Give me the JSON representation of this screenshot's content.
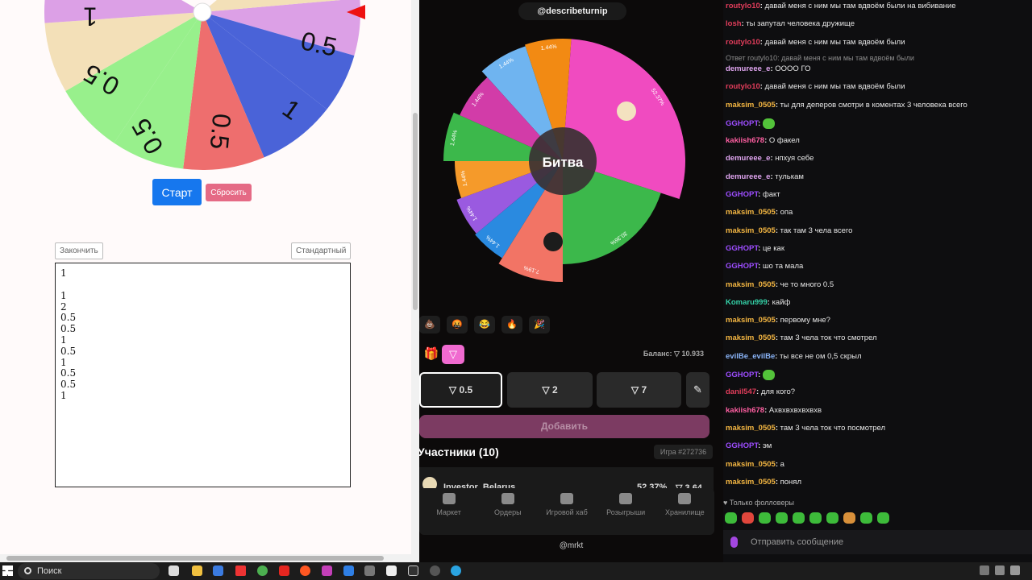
{
  "left": {
    "wheel_labels": [
      "0.5",
      "0.5",
      "0.5",
      "1",
      "0.5",
      "1"
    ],
    "start_label": "Старт",
    "reset_label": "Сбросить",
    "finish_label": "Закончить",
    "standard_label": "Стандартный",
    "textarea_lines": [
      "1",
      "",
      "1",
      "2",
      "0.5",
      "0.5",
      "1",
      "0.5",
      "1",
      "0.5",
      "0.5",
      "1"
    ]
  },
  "middle": {
    "top_user": "@describeturnip",
    "battle_label": "Битва",
    "segment_labels": [
      "1.44%",
      "1.44%",
      "52.37%",
      "30.36%",
      "7.19%",
      "1.44%",
      "1.44%",
      "1.44%",
      "1.44%",
      "1.44%"
    ],
    "emojis": [
      "💩",
      "🤬",
      "😂",
      "🔥",
      "🎉"
    ],
    "balance": "Баланс: ▽ 10.933",
    "bets": [
      "▽ 0.5",
      "▽ 2",
      "▽ 7"
    ],
    "add_label": "Добавить",
    "participants": "Участники (10)",
    "game_id": "Игра #272736",
    "participant_row": {
      "name": "Investor_Belarus",
      "percent": "52.37%",
      "amount": "▽ 3.64"
    },
    "nav": [
      "Маркет",
      "Ордеры",
      "Игровой хаб",
      "Розыгрыши",
      "Хранилище"
    ],
    "bottom_user": "@mrkt"
  },
  "chat": {
    "messages": [
      {
        "user": "routylo10",
        "color": "#e23d5b",
        "text": "давай меня с ним мы там вдвоём были на вибивание"
      },
      {
        "user": "losh",
        "color": "#e23d5b",
        "text": "ты запутал человека дружище"
      },
      {
        "user": "routylo10",
        "color": "#e23d5b",
        "text": "давай меня с ним мы там вдвоём были"
      },
      {
        "reply": "Ответ routylo10: давай меня с ним мы там вдвоём были"
      },
      {
        "user": "demureee_e",
        "color": "#e0a5f0",
        "text": "ОООО ГО"
      },
      {
        "user": "routylo10",
        "color": "#e23d5b",
        "text": "давай меня с ним мы там вдвоём были"
      },
      {
        "user": "maksim_0505",
        "color": "#f4b642",
        "text": "ты для деперов смотри в коментах 3 человека всего"
      },
      {
        "user": "GGHOPT",
        "color": "#9d4dff",
        "text": "",
        "emote": true
      },
      {
        "user": "kakiish678",
        "color": "#ff5fa2",
        "text": "О факел"
      },
      {
        "user": "demureee_e",
        "color": "#e0a5f0",
        "text": "нпхуя себе"
      },
      {
        "user": "demureee_e",
        "color": "#e0a5f0",
        "text": "тулькам"
      },
      {
        "user": "GGHOPT",
        "color": "#9d4dff",
        "text": "факт"
      },
      {
        "user": "maksim_0505",
        "color": "#f4b642",
        "text": "опа"
      },
      {
        "user": "maksim_0505",
        "color": "#f4b642",
        "text": "так там 3 чела всего"
      },
      {
        "user": "GGHOPT",
        "color": "#9d4dff",
        "text": "це как"
      },
      {
        "user": "GGHOPT",
        "color": "#9d4dff",
        "text": "шо та мала"
      },
      {
        "user": "maksim_0505",
        "color": "#f4b642",
        "text": "че то много 0.5"
      },
      {
        "user": "Komaru999",
        "color": "#34d2a8",
        "text": "кайф"
      },
      {
        "user": "maksim_0505",
        "color": "#f4b642",
        "text": "первому мне?"
      },
      {
        "user": "maksim_0505",
        "color": "#f4b642",
        "text": "там 3 чела ток что смотрел"
      },
      {
        "user": "evilBe_evilBe",
        "color": "#8ab4f8",
        "text": "ты все не ом 0,5 скрыл"
      },
      {
        "user": "GGHOPT",
        "color": "#9d4dff",
        "text": "",
        "emote": true
      },
      {
        "user": "danil547",
        "color": "#e23d5b",
        "text": "для кого?"
      },
      {
        "user": "kakiish678",
        "color": "#ff5fa2",
        "text": "Ахвхвхвхвхвхв"
      },
      {
        "user": "maksim_0505",
        "color": "#f4b642",
        "text": "там 3 чела ток что посмотрел"
      },
      {
        "user": "GGHOPT",
        "color": "#9d4dff",
        "text": "эм"
      },
      {
        "user": "maksim_0505",
        "color": "#f4b642",
        "text": "а"
      },
      {
        "user": "maksim_0505",
        "color": "#f4b642",
        "text": "понял"
      }
    ],
    "followers_only": "Только фолловеры",
    "send_placeholder": "Отправить сообщение"
  },
  "taskbar": {
    "search_label": "Поиск"
  }
}
